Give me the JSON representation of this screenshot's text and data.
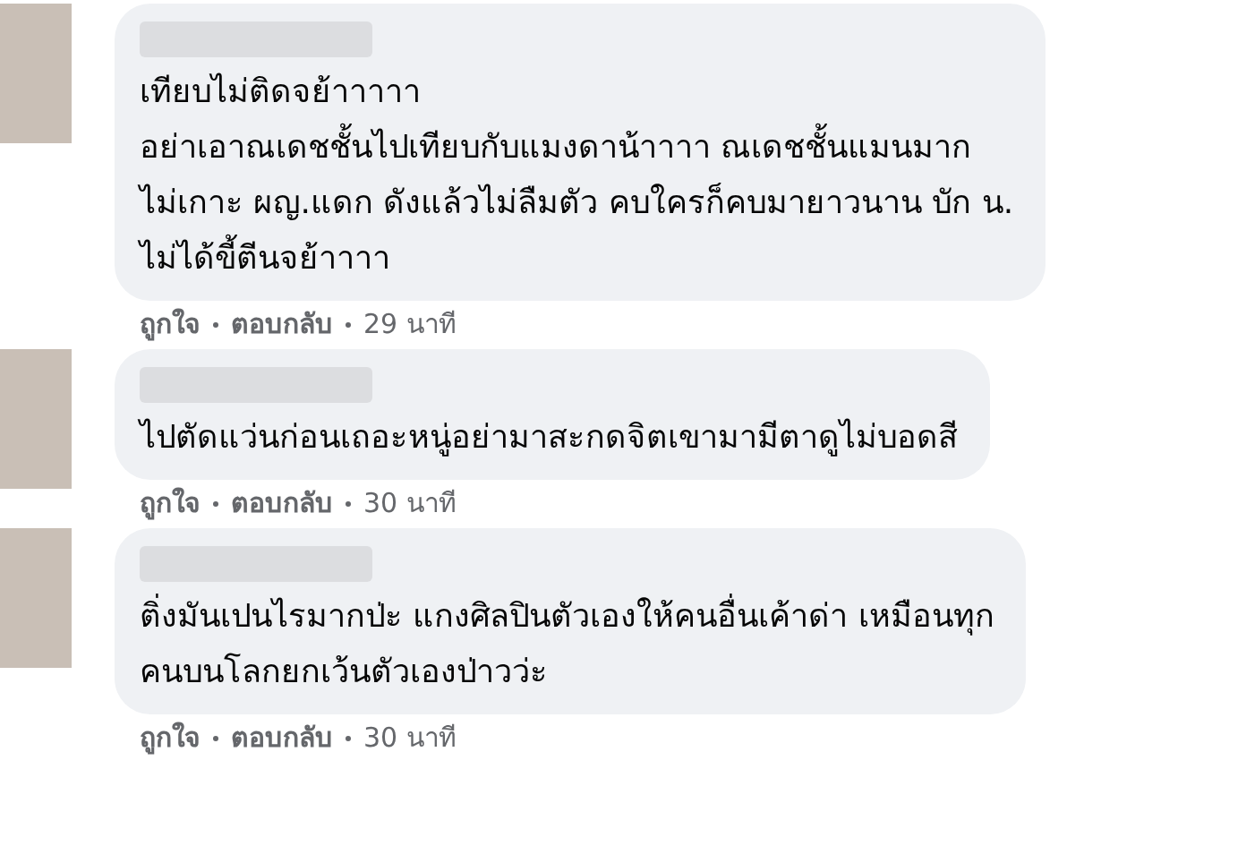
{
  "comments": [
    {
      "text": "เทียบไม่ติดจย้าาาาา\nอย่าเอาณเดชชั้นไปเทียบกับแมงดาน้าาาา ณเดชชั้นแมนมาก\nไม่เกาะ ผญ.แดก ดังแล้วไม่ลืมตัว คบใครก็คบมายาวนาน บัก น.\nไม่ได้ขี้ตีนจย้าาาา",
      "like": "ถูกใจ",
      "reply": "ตอบกลับ",
      "time": "29 นาที"
    },
    {
      "text": "ไปตัดแว่นก่อนเถอะหนู่อย่ามาสะกดจิตเขามามีตาดูไม่บอดสี",
      "like": "ถูกใจ",
      "reply": "ตอบกลับ",
      "time": "30 นาที"
    },
    {
      "text": "ติ่งมันเปนไรมากป่ะ แกงศิลปินตัวเองให้คนอื่นเค้าด่า เหมือนทุก\nคนบนโลกยกเว้นตัวเองป่าวว่ะ",
      "like": "ถูกใจ",
      "reply": "ตอบกลับ",
      "time": "30 นาที"
    }
  ]
}
